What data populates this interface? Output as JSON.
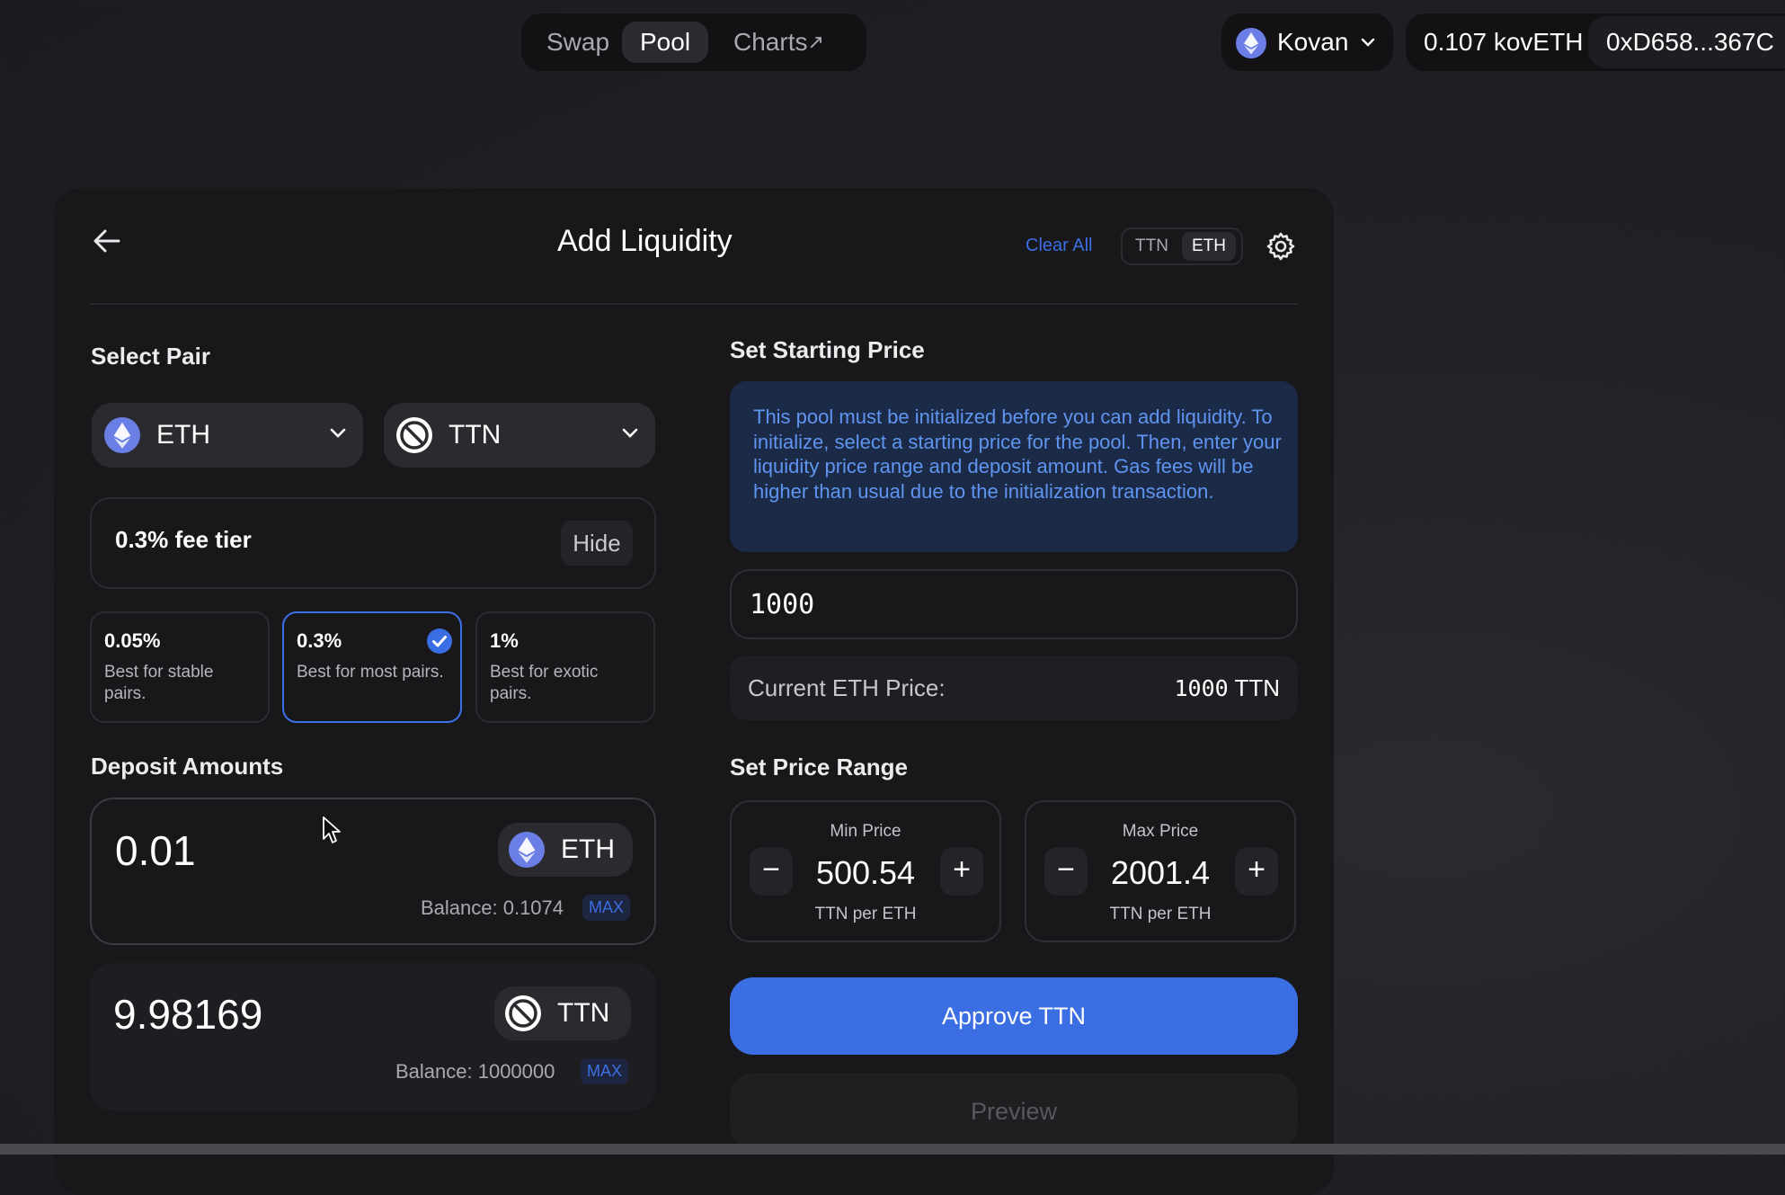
{
  "nav": {
    "tabs": [
      {
        "label": "Swap"
      },
      {
        "label": "Pool"
      },
      {
        "label": "Charts",
        "suffix": "↗"
      }
    ],
    "active_tab": "Pool"
  },
  "network": {
    "name": "Kovan"
  },
  "account": {
    "balance": "0.107 kovETH",
    "address": "0xD658...367C"
  },
  "card": {
    "title": "Add Liquidity",
    "clear_all": "Clear All",
    "denom_toggle": [
      "TTN",
      "ETH"
    ],
    "denom_selected": "ETH"
  },
  "select_pair": {
    "heading": "Select Pair",
    "token_a": "ETH",
    "token_b": "TTN"
  },
  "fee_tier": {
    "label": "0.3% fee tier",
    "hide_label": "Hide",
    "options": [
      {
        "pct": "0.05%",
        "desc": "Best for stable pairs."
      },
      {
        "pct": "0.3%",
        "desc": "Best for most pairs.",
        "selected": true
      },
      {
        "pct": "1%",
        "desc": "Best for exotic pairs."
      }
    ]
  },
  "deposit": {
    "heading": "Deposit Amounts",
    "rows": [
      {
        "amount": "0.01",
        "token": "ETH",
        "balance": "Balance: 0.1074",
        "max": "MAX"
      },
      {
        "amount": "9.98169",
        "token": "TTN",
        "balance": "Balance: 1000000",
        "max": "MAX"
      }
    ]
  },
  "starting_price": {
    "heading": "Set Starting Price",
    "notice": "This pool must be initialized before you can add liquidity. To initialize, select a starting price for the pool. Then, enter your liquidity price range and deposit amount. Gas fees will be higher than usual due to the initialization transaction.",
    "input_value": "1000",
    "current_label": "Current ETH Price:",
    "current_value": "1000",
    "current_unit": "TTN"
  },
  "price_range": {
    "heading": "Set Price Range",
    "min": {
      "caption": "Min Price",
      "value": "500.54",
      "unit": "TTN per ETH"
    },
    "max": {
      "caption": "Max Price",
      "value": "2001.4",
      "unit": "TTN per ETH"
    },
    "decrement": "−",
    "increment": "+"
  },
  "actions": {
    "approve": "Approve TTN",
    "preview": "Preview"
  },
  "colors": {
    "accent": "#3b6ee3",
    "eth_icon": "#6a7ee6",
    "info_bg": "#1b2a47",
    "info_text": "#5f95f0"
  },
  "icons": [
    "eth-icon",
    "ttn-icon",
    "chevron-down-icon",
    "back-arrow-icon",
    "gear-icon",
    "check-icon",
    "cursor-icon"
  ]
}
